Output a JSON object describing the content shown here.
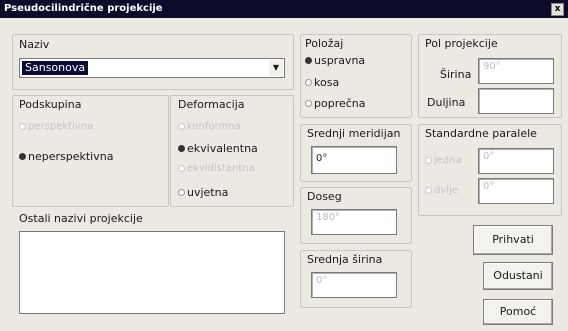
{
  "window": {
    "title": "Pseudocilindrične projekcije",
    "close_label": "x"
  },
  "naziv": {
    "label": "Naziv",
    "value": "Sansonova"
  },
  "podskupina": {
    "label": "Podskupina",
    "options": [
      "perspektivna",
      "neperspektivna"
    ],
    "selected": "neperspektivna"
  },
  "deformacija": {
    "label": "Deformacija",
    "options": [
      "konformna",
      "ekvivalentna",
      "ekvidistantna",
      "uvjetna"
    ],
    "selected": "ekvivalentna"
  },
  "ostali": {
    "label": "Ostali nazivi projekcije",
    "value": ""
  },
  "polozaj": {
    "label": "Položaj",
    "options": [
      "uspravna",
      "kosa",
      "poprečna"
    ],
    "selected": "uspravna"
  },
  "pol_projekcije": {
    "label": "Pol projekcije",
    "sirina_label": "Širina",
    "sirina_value": "90°",
    "duljina_label": "Duljina",
    "duljina_value": ""
  },
  "srednji_meridijan": {
    "label": "Srednji meridijan",
    "value": "0°"
  },
  "doseg": {
    "label": "Doseg",
    "value": "180°"
  },
  "srednja_sirina": {
    "label": "Srednja širina",
    "value": "0°"
  },
  "standardne_paralele": {
    "label": "Standardne paralele",
    "prva_label": "jedna",
    "prva_value": "0°",
    "druga_label": "dvije",
    "druga_value": "0°"
  },
  "buttons": {
    "prihvati": "Prihvati",
    "odustani": "Odustani",
    "pomoc": "Pomoć"
  }
}
